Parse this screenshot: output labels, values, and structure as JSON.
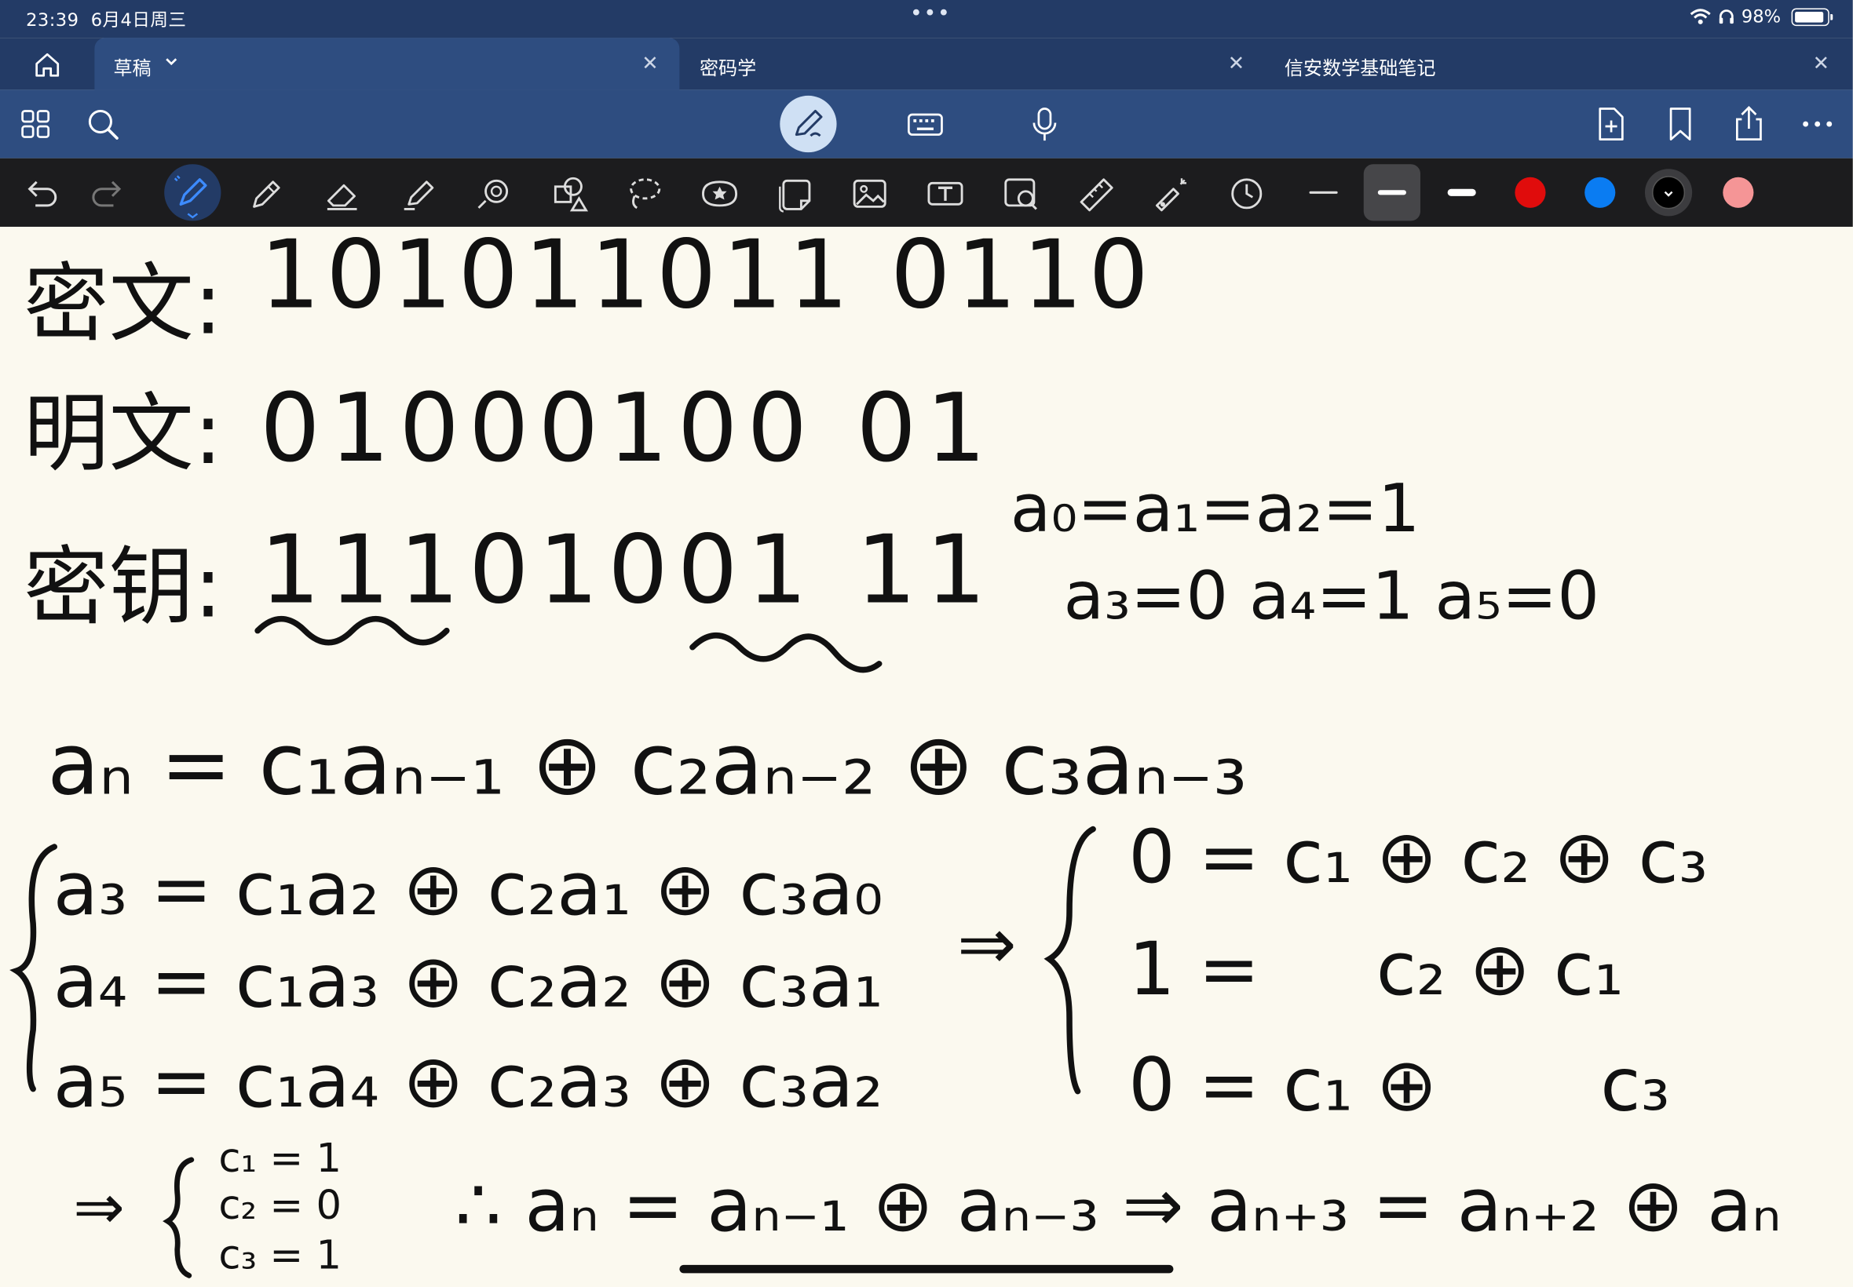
{
  "status_bar": {
    "time": "23:39",
    "date": "6月4日周三",
    "battery": "98%"
  },
  "tabs": [
    {
      "label": "草稿",
      "active": true
    },
    {
      "label": "密码学",
      "active": false
    },
    {
      "label": "信安数学基础笔记",
      "active": false
    }
  ],
  "toolbar": {
    "left_icons": [
      "grid-icon",
      "search-icon"
    ],
    "center_icons": [
      "pencil-mode-icon",
      "keyboard-icon",
      "microphone-icon"
    ],
    "right_icons": [
      "add-page-icon",
      "bookmark-icon",
      "share-icon",
      "more-icon"
    ]
  },
  "tools": {
    "icons": [
      "undo-icon",
      "redo-icon",
      "pen-icon",
      "pencil-icon",
      "eraser-icon",
      "highlighter-icon",
      "shape-icon",
      "element-icon",
      "lasso-icon",
      "sticker-icon",
      "sticky-note-icon",
      "image-icon",
      "text-icon",
      "zoom-window-icon",
      "ruler-icon",
      "laser-pointer-icon",
      "recent-icon"
    ],
    "selected_width": 2,
    "colors": [
      "#e00c0c",
      "#0a7cf2",
      "#000000",
      "#f59596"
    ],
    "selected_color": "#000000"
  },
  "notes": {
    "ciphertext_label": "密文:",
    "ciphertext_bits": "101011011 0110",
    "plaintext_label": "明文:",
    "plaintext_bits": "01000100 01",
    "key_label": "密钥:",
    "key_bits": "11101001 11",
    "init_line1": "a₀=a₁=a₂=1",
    "init_line2": "a₃=0   a₄=1   a₅=0",
    "recurrence": "aₙ = c₁aₙ₋₁ ⊕ c₂aₙ₋₂ ⊕ c₃aₙ₋₃",
    "sys_left": [
      "a₃ = c₁a₂ ⊕ c₂a₁ ⊕ c₃a₀",
      "a₄ = c₁a₃ ⊕ c₂a₂ ⊕ c₃a₁",
      "a₅ = c₁a₄ ⊕ c₂a₃ ⊕ c₃a₂"
    ],
    "implies": "⇒",
    "sys_right": [
      "0 = c₁ ⊕ c₂ ⊕ c₃",
      "1 =     c₂ ⊕ c₁",
      "0 = c₁ ⊕       c₃"
    ],
    "solution": [
      "c₁ = 1",
      "c₂ = 0",
      "c₃ = 1"
    ],
    "conclusion": "∴ aₙ = aₙ₋₁ ⊕ aₙ₋₃ ⇒ aₙ₊₃ = aₙ₊₂ ⊕ aₙ"
  }
}
